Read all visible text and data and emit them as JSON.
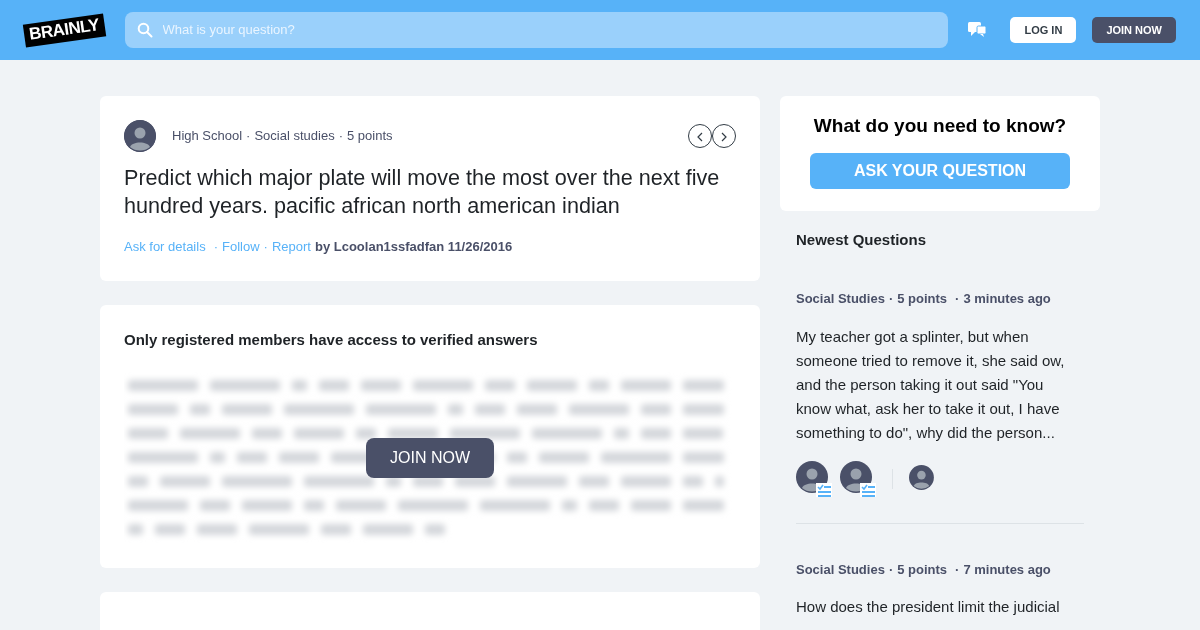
{
  "header": {
    "logo": "BRAINLY",
    "search": {
      "placeholder": "What is your question?"
    },
    "login": "LOG IN",
    "join": "JOIN NOW"
  },
  "separator": "·",
  "question": {
    "meta": [
      "High School",
      "Social studies",
      "5 points"
    ],
    "text": "Predict which major plate will move the most over the next five hundred years. pacific african north american indian",
    "actions": [
      "Ask for details",
      "Follow",
      "Report"
    ],
    "byline": "by Lcoolan1ssfadfan 11/26/2016"
  },
  "answer_gate": {
    "title": "Only registered members have access to verified answers",
    "join": "JOIN NOW"
  },
  "ask": {
    "title": "What do you need to know?",
    "button": "ASK YOUR QUESTION"
  },
  "newest": {
    "title": "Newest Questions",
    "items": [
      {
        "subject": "Social Studies",
        "points": "5 points",
        "time": "3 minutes ago",
        "text": "My teacher got a splinter, but when someone tried to remove it, she said ow, and the person taking it out said \"You know what, ask her to take it out, I have something to do\", why did the person...",
        "answerers": [
          {
            "verified": true
          },
          {
            "verified": true
          },
          {
            "verified": false
          }
        ]
      },
      {
        "subject": "Social Studies",
        "points": "5 points",
        "time": "7 minutes ago",
        "text": "How does the president limit the judicial"
      }
    ]
  }
}
